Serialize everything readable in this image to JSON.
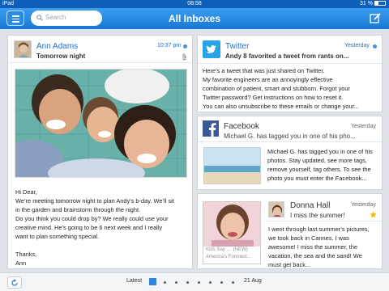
{
  "status_bar": {
    "carrier": "iPad",
    "time": "08:58",
    "battery": "31 %"
  },
  "navbar": {
    "title": "All Inboxes",
    "search_placeholder": "Search"
  },
  "email_main": {
    "sender": "Ann Adams",
    "time": "10:37 pm",
    "subject": "Tomorrow night",
    "body": [
      "Hi Dear,",
      "We’re meeting tomorrow night to plan Andy’s b-day. We’ll sit",
      "in the garden and brainstorm through the night.",
      "Do you think you could drop by? We really could use your",
      "creative mind. He’s going to be 6 next week and I really",
      "want to plan something special.",
      "",
      "Thanks,",
      "Ann"
    ]
  },
  "email_twitter": {
    "sender": "Twitter",
    "time": "Yesterday",
    "subject": "Andy 8 favorited a tweet from rants on...",
    "body": [
      "Here’s a tweet that was just shared on Twitter.",
      "My favorite engineers are an annoyingly effective",
      "combination of patient, smart and stubborn. Forgot your",
      "Twitter password? Get instructions on how to reset it.",
      "You can also unsubscribe to these emails or change your..."
    ]
  },
  "email_facebook": {
    "sender": "Facebook",
    "time": "Yesterday",
    "subject": "Michael G. has tagged you in one of his pho...",
    "body": [
      "Michael G. has tagged you in one of his",
      "photos. Stay updated, see more tags,",
      "remove yourself, tag others. To see the",
      "photo you must enter the Facebook..."
    ]
  },
  "email_donna": {
    "sender": "Donna Hall",
    "time": "Yesterday",
    "subject": "I miss the summer!",
    "preview_caption": [
      "Kids Say .... (NEW)",
      "America's Funniest..."
    ],
    "body": [
      "I went through last summer’s pictures,",
      "we took back in Cannes. I was",
      "awesome! I miss the summer, the",
      "vacation, the sea and the sand! We",
      "must get back..."
    ]
  },
  "pager": {
    "start_label": "Latest",
    "end_label": "21 Aug"
  },
  "colors": {
    "accent": "#1f6ec8",
    "navbar": "#1877d6",
    "twitter": "#2aa3e6",
    "facebook": "#3b5998",
    "star": "#f5b800"
  },
  "icons": [
    "menu-icon",
    "search-icon",
    "compose-icon",
    "paperclip-icon",
    "twitter-logo-icon",
    "facebook-logo-icon",
    "star-icon",
    "refresh-icon"
  ]
}
